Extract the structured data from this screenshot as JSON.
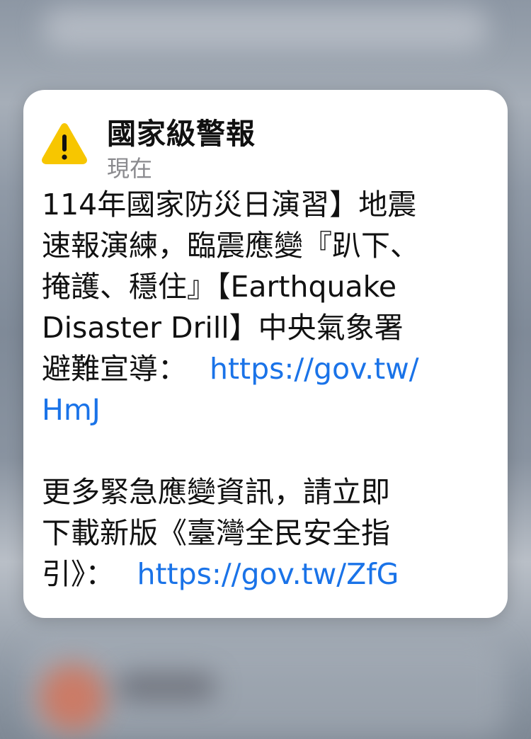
{
  "colors": {
    "card_background": "#ffffff",
    "title_text": "#111111",
    "time_text": "#8a8a8e",
    "link": "#1a73e8",
    "warning_icon": "#f7c600"
  },
  "alert": {
    "icon": "warning-triangle-icon",
    "title": "國家級警報",
    "time": "現在",
    "paragraph1": {
      "line1": "114年國家防災日演習】地震",
      "line2": "速報演練，臨震應變『趴下、",
      "line3": "掩護、穩住』【Earthquake",
      "line4": "Disaster Drill】中央氣象署",
      "line5_text": "避難宣導：",
      "link1_part1": "https://gov.tw/",
      "link1_part2": "HmJ"
    },
    "paragraph2": {
      "line1": "更多緊急應變資訊，請立即",
      "line2": "下載新版《臺灣全民安全指",
      "line3_text": "引》：",
      "link2": "https://gov.tw/ZfG"
    }
  }
}
